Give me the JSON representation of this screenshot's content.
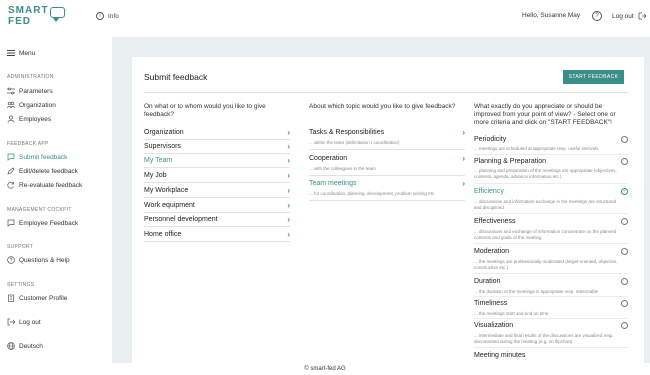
{
  "brand": {
    "line1": "SMART",
    "line2": "FED"
  },
  "topbar": {
    "info": "Info",
    "greeting": "Hello, Susanne May",
    "help": "?",
    "logout": "Log out"
  },
  "sidebar": {
    "menu": "Menu",
    "sections": [
      {
        "head": "ADMINISTRATION",
        "items": [
          "Parameters",
          "Organization",
          "Employees"
        ]
      },
      {
        "head": "FEEDBACK APP",
        "items": [
          "Submit feedback",
          "Edit/delete feedback",
          "Re-evaluate feedback"
        ]
      },
      {
        "head": "MANAGEMENT COCKPIT",
        "items": [
          "Employee Feedback"
        ]
      },
      {
        "head": "SUPPORT",
        "items": [
          "Questions & Help"
        ]
      },
      {
        "head": "SETTINGS",
        "items": [
          "Customer Profile"
        ]
      }
    ],
    "logout": "Log out",
    "language": "Deutsch",
    "active_item": "Submit feedback"
  },
  "main": {
    "title": "Submit feedback",
    "start_button": "START FEEDBACK",
    "col1": {
      "question": "On what or to whom would you like to give feedback?",
      "items": [
        "Organization",
        "Supervisors",
        "My Team",
        "My Job",
        "My Workplace",
        "Work equipment",
        "Personnel development",
        "Home office"
      ],
      "active": "My Team"
    },
    "col2": {
      "question": "About which topic would you like to give feedback?",
      "items": [
        {
          "label": "Tasks & Responsibilities",
          "desc": "... within the team (delimitation / coordination)"
        },
        {
          "label": "Cooperation",
          "desc": "... with the colleagues in the team"
        },
        {
          "label": "Team meetings",
          "desc": "... for coordination, planning, development, problem solving etc."
        }
      ],
      "active": "Team meetings"
    },
    "col3": {
      "question": "What exactly do you appreciate or should be improved from your point of view? - Select one or more criteria and click on \"START FEEDBACK\"!",
      "criteria": [
        {
          "label": "Periodicity",
          "desc": "... meetings are scheduled at appropriate resp. useful intervals",
          "checked": false
        },
        {
          "label": "Planning & Preparation",
          "desc": "... planning and preparation of the meetings are appropriate (objectives, contents, agenda, advance information etc.)",
          "checked": false
        },
        {
          "label": "Efficiency",
          "desc": "... discussions and information exchange in the meetings are structured and disciplined",
          "checked": true
        },
        {
          "label": "Effectiveness",
          "desc": "... discussions and exchange of information concentrate on the planned contents and goals of the meeting",
          "checked": false
        },
        {
          "label": "Moderation",
          "desc": "... the meetings are professionally moderated (target-oriented, objective, constructive etc.)",
          "checked": false
        },
        {
          "label": "Duration",
          "desc": "... the duration of the meetings is appropriate resp. reasonable",
          "checked": false
        },
        {
          "label": "Timeliness",
          "desc": "... the meetings start and end on time",
          "checked": false
        },
        {
          "label": "Visualization",
          "desc": "... intermediate and final results of the discussions are visualized resp. documented during the meeting (e.g. on flipchart)",
          "checked": false
        },
        {
          "label": "Meeting minutes",
          "desc": "",
          "checked": false
        }
      ]
    }
  },
  "footer": {
    "copyright": "© smart-fed AG"
  },
  "colors": {
    "accent": "#3a8f8b",
    "background": "#e9eef1"
  }
}
